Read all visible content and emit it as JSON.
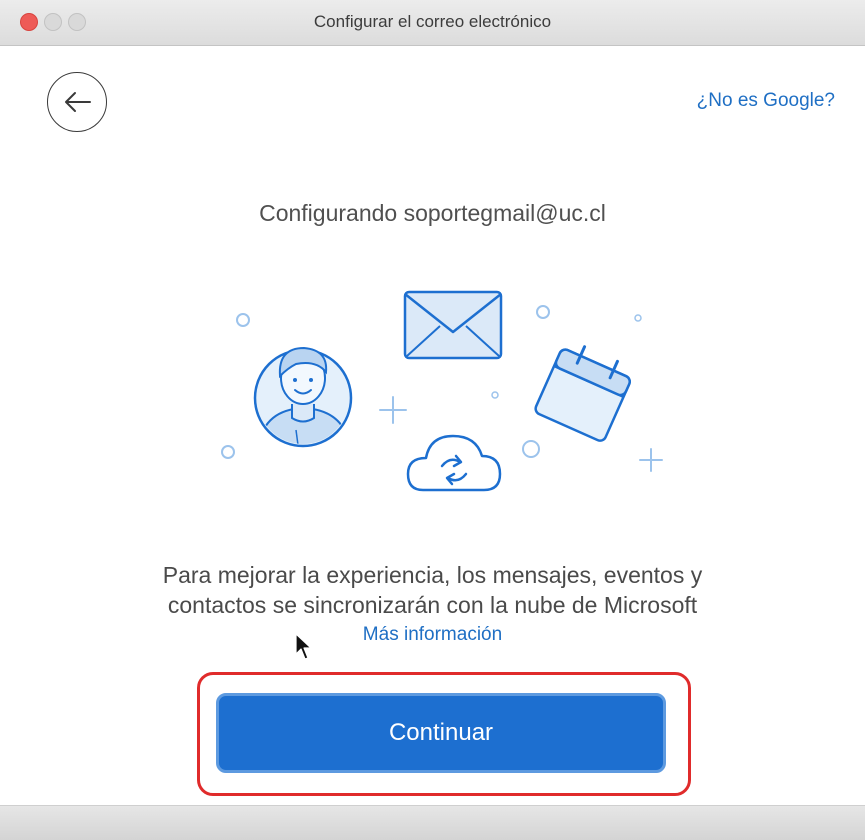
{
  "window": {
    "title": "Configurar el correo electrónico"
  },
  "header": {
    "not_google_link": "¿No es Google?"
  },
  "main": {
    "heading": "Configurando soportegmail@uc.cl",
    "privacy_line1": "Para mejorar la experiencia, los mensajes, eventos y",
    "privacy_line2": "contactos se sincronizarán con la nube de Microsoft",
    "more_info_link": "Más información",
    "continue_label": "Continuar"
  },
  "colors": {
    "accent": "#1d6fd0",
    "link": "#1f6fc4",
    "highlight": "#e02b2b"
  },
  "icons": [
    "back-arrow-icon",
    "person-icon",
    "envelope-icon",
    "calendar-icon",
    "cloud-sync-icon"
  ]
}
